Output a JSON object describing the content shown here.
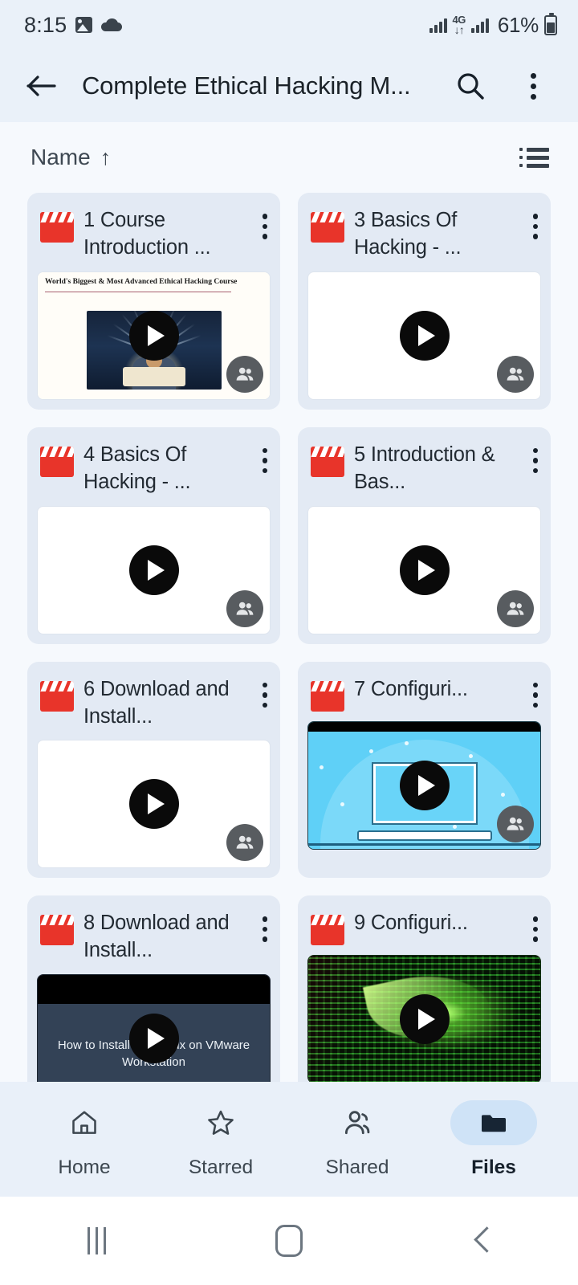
{
  "status_bar": {
    "time": "8:15",
    "battery_percent": "61%",
    "network_type": "4G",
    "icons": [
      "gallery-icon",
      "cloud-icon",
      "signal-bars-icon",
      "data-transfer-icon",
      "signal-bars-icon",
      "battery-icon"
    ]
  },
  "toolbar": {
    "back_label": "←",
    "title": "Complete Ethical Hacking M...",
    "search_label": "search-icon",
    "overflow_label": "more-options-icon"
  },
  "sort_bar": {
    "sort_field": "Name",
    "sort_direction": "↑",
    "view_toggle": "list-view-icon"
  },
  "colors": {
    "page_background": "#F6F9FD",
    "toolbar_background": "#EAF1F9",
    "card_background": "#E3EAF4",
    "accent_pill": "#CFE3F7",
    "video_icon_red": "#E8342A",
    "shared_badge_gray": "#585C60",
    "text_primary": "#1B2228"
  },
  "files": [
    {
      "title": "1 Course Introduction ...",
      "icon": "video-file-icon",
      "menu": "file-overflow-icon",
      "shared": true,
      "thumb_type": "slide",
      "thumb_caption": "World's Biggest & Most Advanced Ethical Hacking Course",
      "thumb_caption_lead": "W"
    },
    {
      "title": "3 Basics Of Hacking - ...",
      "icon": "video-file-icon",
      "menu": "file-overflow-icon",
      "shared": true,
      "thumb_type": "blank",
      "thumb_caption": ""
    },
    {
      "title": "4 Basics Of Hacking - ...",
      "icon": "video-file-icon",
      "menu": "file-overflow-icon",
      "shared": true,
      "thumb_type": "blank",
      "thumb_caption": ""
    },
    {
      "title": "5 Introduction & Bas...",
      "icon": "video-file-icon",
      "menu": "file-overflow-icon",
      "shared": true,
      "thumb_type": "blank",
      "thumb_caption": ""
    },
    {
      "title": "6 Download and Install...",
      "icon": "video-file-icon",
      "menu": "file-overflow-icon",
      "shared": true,
      "thumb_type": "blank",
      "thumb_caption": ""
    },
    {
      "title": "7 Configuri...",
      "icon": "video-file-icon",
      "menu": "file-overflow-icon",
      "shared": true,
      "thumb_type": "blue-laptop",
      "thumb_caption": ""
    },
    {
      "title": "8 Download and Install...",
      "icon": "video-file-icon",
      "menu": "file-overflow-icon",
      "shared": false,
      "thumb_type": "dark-video",
      "thumb_caption": "How to Install Kali Linux on VMware Workstation"
    },
    {
      "title": "9 Configuri...",
      "icon": "video-file-icon",
      "menu": "file-overflow-icon",
      "shared": false,
      "thumb_type": "green-matrix",
      "thumb_caption": ""
    }
  ],
  "bottom_nav": {
    "items": [
      {
        "label": "Home",
        "icon": "home-icon",
        "active": false
      },
      {
        "label": "Starred",
        "icon": "star-icon",
        "active": false
      },
      {
        "label": "Shared",
        "icon": "people-icon",
        "active": false
      },
      {
        "label": "Files",
        "icon": "folder-icon",
        "active": true
      }
    ]
  },
  "system_nav": {
    "recents": "recents-icon",
    "home": "home-button-icon",
    "back": "back-button-icon"
  }
}
